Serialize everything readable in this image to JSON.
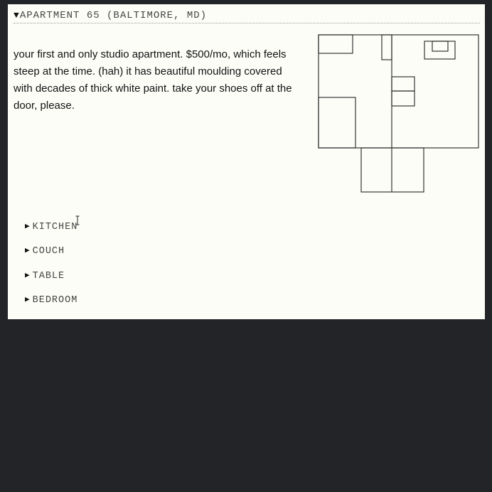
{
  "section": {
    "title": "APARTMENT 65 (BALTIMORE, MD)",
    "expanded_icon": "triangle-down-icon"
  },
  "description": "your first and only studio apartment. $500/mo, which feels steep at the time. (hah) it has beautiful moulding covered with decades of thick white paint. take your shoes off at the door, please.",
  "subsections": [
    {
      "label": "KITCHEN",
      "icon": "triangle-right-icon"
    },
    {
      "label": "COUCH",
      "icon": "triangle-right-icon"
    },
    {
      "label": "TABLE",
      "icon": "triangle-right-icon"
    },
    {
      "label": "BEDROOM",
      "icon": "triangle-right-icon"
    }
  ],
  "colors": {
    "page_background": "#232427",
    "panel_background": "#fdfdf8",
    "line": "#333333"
  }
}
